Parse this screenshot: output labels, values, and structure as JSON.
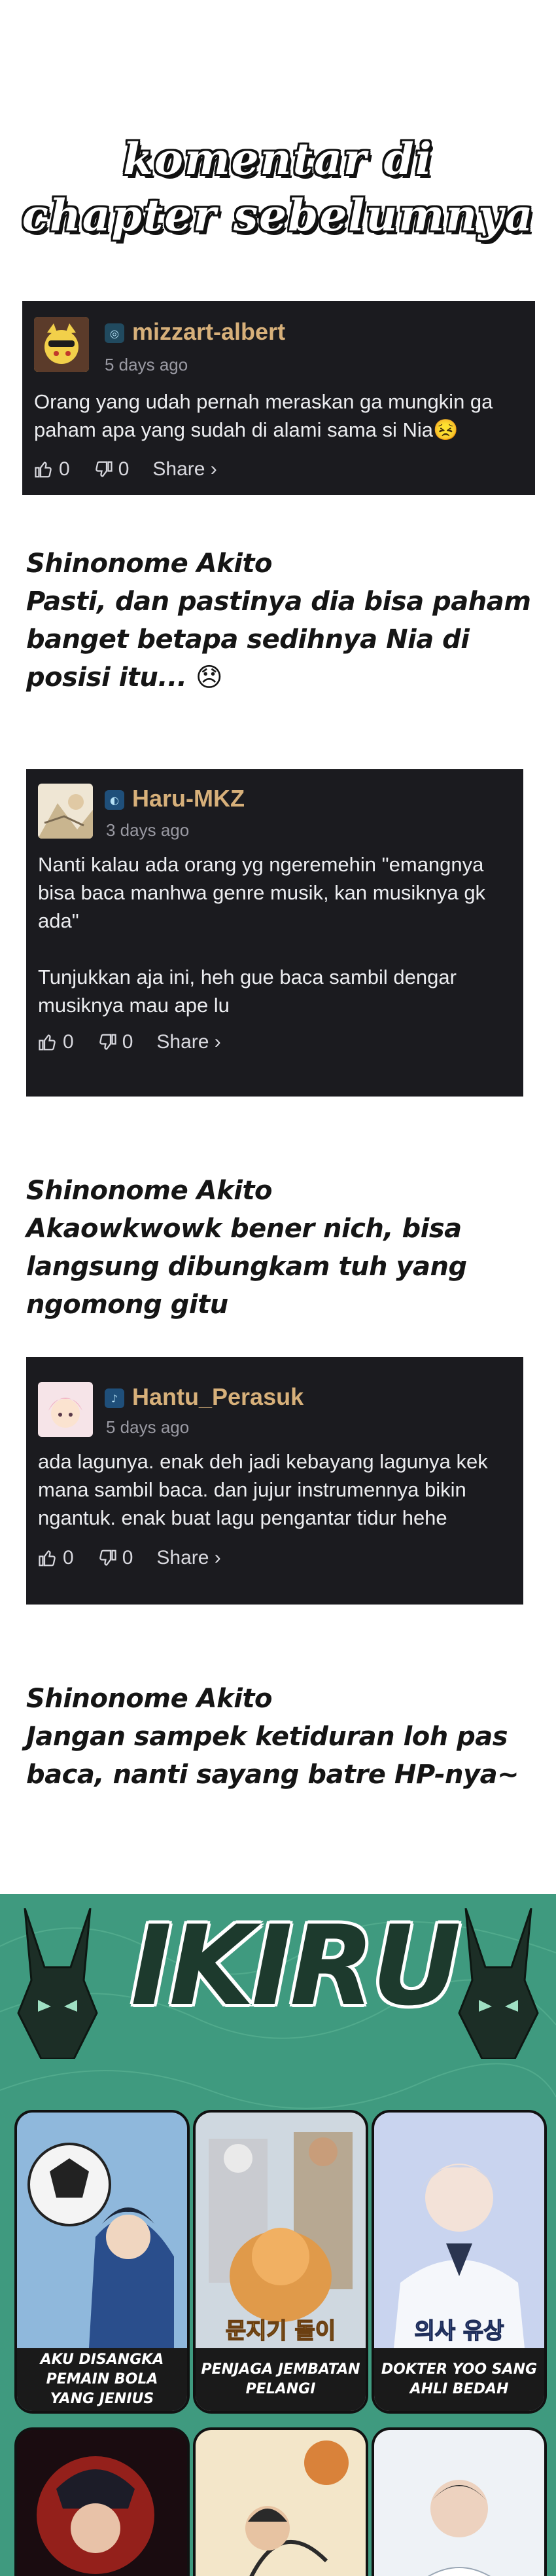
{
  "header": {
    "title_line1": "komentar di",
    "title_line2": "chapter sebelumnya"
  },
  "comments": [
    {
      "username": "mizzart-albert",
      "time": "5 days ago",
      "text": "Orang yang udah pernah meraskan ga mungkin ga paham apa yang sudah di alami sama si Nia😣",
      "likes": "0",
      "dislikes": "0",
      "share": "Share ›"
    },
    {
      "username": "Haru-MKZ",
      "time": "3 days ago",
      "text": "Nanti kalau ada orang yg ngeremehin \"emangnya bisa baca manhwa genre musik, kan musiknya gk ada\"\n\nTunjukkan aja ini, heh gue baca sambil dengar musiknya mau ape lu",
      "likes": "0",
      "dislikes": "0",
      "share": "Share ›"
    },
    {
      "username": "Hantu_Perasuk",
      "time": "5 days ago",
      "text": "ada lagunya. enak deh jadi kebayang lagunya kek mana sambil baca. dan jujur instrumennya bikin ngantuk. enak buat lagu pengantar tidur hehe",
      "likes": "0",
      "dislikes": "0",
      "share": "Share ›"
    }
  ],
  "replies": [
    {
      "author": "Shinonome Akito",
      "text": "Pasti, dan pastinya dia bisa paham banget betapa sedihnya Nia di posisi itu... 😞"
    },
    {
      "author": "Shinonome Akito",
      "text": "Akaowkwowk bener nich, bisa langsung dibungkam tuh yang ngomong gitu"
    },
    {
      "author": "Shinonome Akito",
      "text": "Jangan sampek ketiduran loh pas baca, nanti sayang batre HP-nya~"
    }
  ],
  "banner": {
    "brand": "IKIRU",
    "titles": [
      {
        "caption": "AKU DISANGKA PEMAIN BOLA YANG JENIUS"
      },
      {
        "caption": "PENJAGA JEMBATAN PELANGI"
      },
      {
        "caption": "DOKTER YOO SANG AHLI BEDAH"
      }
    ],
    "tile2_art": "문지기 돌이",
    "tile3_art": "의사 유상"
  },
  "colors": {
    "card_bg": "#1b1b1f",
    "username": "#d7b07a",
    "banner_bg": "#3f9a7f"
  }
}
